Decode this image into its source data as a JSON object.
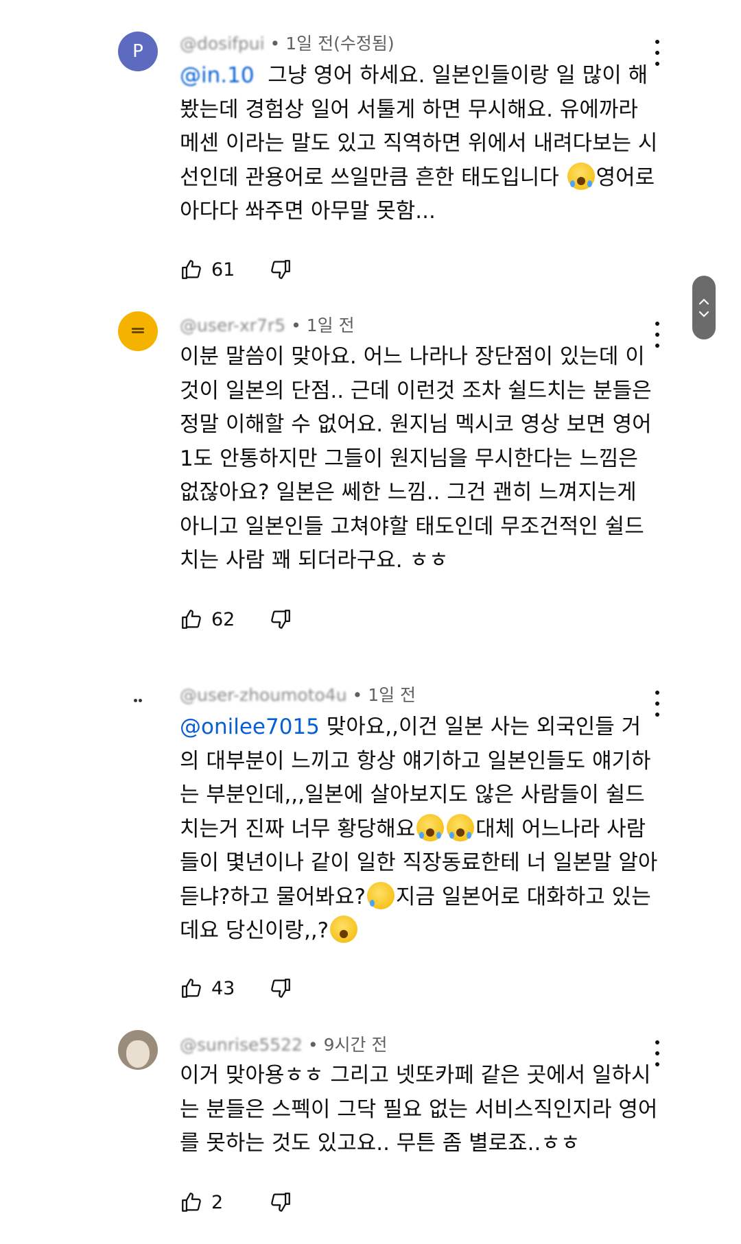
{
  "comments": [
    {
      "avatar_letter": "P",
      "handle": "@dosifpui",
      "time": " • 1일 전(수정됨)",
      "mention": "@in.10",
      "text_before": "",
      "text_after": "그냥 영어 하세요. 일본인들이랑 일 많이 해봤는데 경험상 일어 서툴게 하면 무시해요. 유에까라 메센 이라는 말도 있고 직역하면 위에서 내려다보는 시선인데 관용어로 쓰일만큼 흔한 태도입니다 ",
      "emoji1": "face-with-tears-of-joy",
      "text_end": "영어로 아다다 쏴주면 아무말 못함...",
      "likes": "61"
    },
    {
      "handle": "@user-xr7r5",
      "time": " • 1일 전",
      "text": "이분 말씀이 맞아요. 어느 나라나 장단점이 있는데 이것이 일본의 단점.. 근데 이런것 조차 쉴드치는 분들은 정말 이해할 수 없어요. 원지님 멕시코 영상 보면 영어 1도 안통하지만 그들이 원지님을 무시한다는 느낌은 없잖아요? 일본은 쎄한 느낌.. 그건 괜히 느껴지는게 아니고 일본인들 고쳐야할 태도인데 무조건적인 쉴드치는 사람 꽤 되더라구요. ㅎㅎ",
      "likes": "62"
    },
    {
      "handle": "@user-zhoumoto4u",
      "time": " • 1일 전",
      "mention": "@onilee7015",
      "text_a": " 맞아요,,이건 일본 사는 외국인들 거의 대부분이 느끼고 항상 얘기하고 일본인들도 얘기하는 부분인데,,,일본에 살아보지도 않은 사람들이 쉴드 치는거 진짜 너무 황당해요",
      "text_b": "대체 어느나라 사람들이 몇년이나 같이 일한 직장동료한테 너 일본말 알아듣냐?하고 물어봐요?",
      "text_c": "지금 일본어로 대화하고 있는데요 당신이랑,,?",
      "likes": "43"
    },
    {
      "handle": "@sunrise5522",
      "time": " • 9시간 전",
      "text": "이거 맞아용ㅎㅎ 그리고 넷또카페 같은 곳에서 일하시는 분들은 스펙이 그닥 필요 없는 서비스직인지라 영어를 못하는 것도 있고요.. 무튼 좀 별로죠..ㅎㅎ",
      "likes": "2"
    }
  ],
  "icons": {
    "like": "thumbs-up-icon",
    "dislike": "thumbs-down-icon",
    "menu": "more-vert-icon",
    "scroll_up": "chevron-up-icon",
    "scroll_down": "chevron-down-icon"
  },
  "colors": {
    "mention": "#065fd4",
    "meta": "#606060",
    "avatar_p": "#5c6bc0",
    "avatar_yellow": "#f5b300"
  }
}
